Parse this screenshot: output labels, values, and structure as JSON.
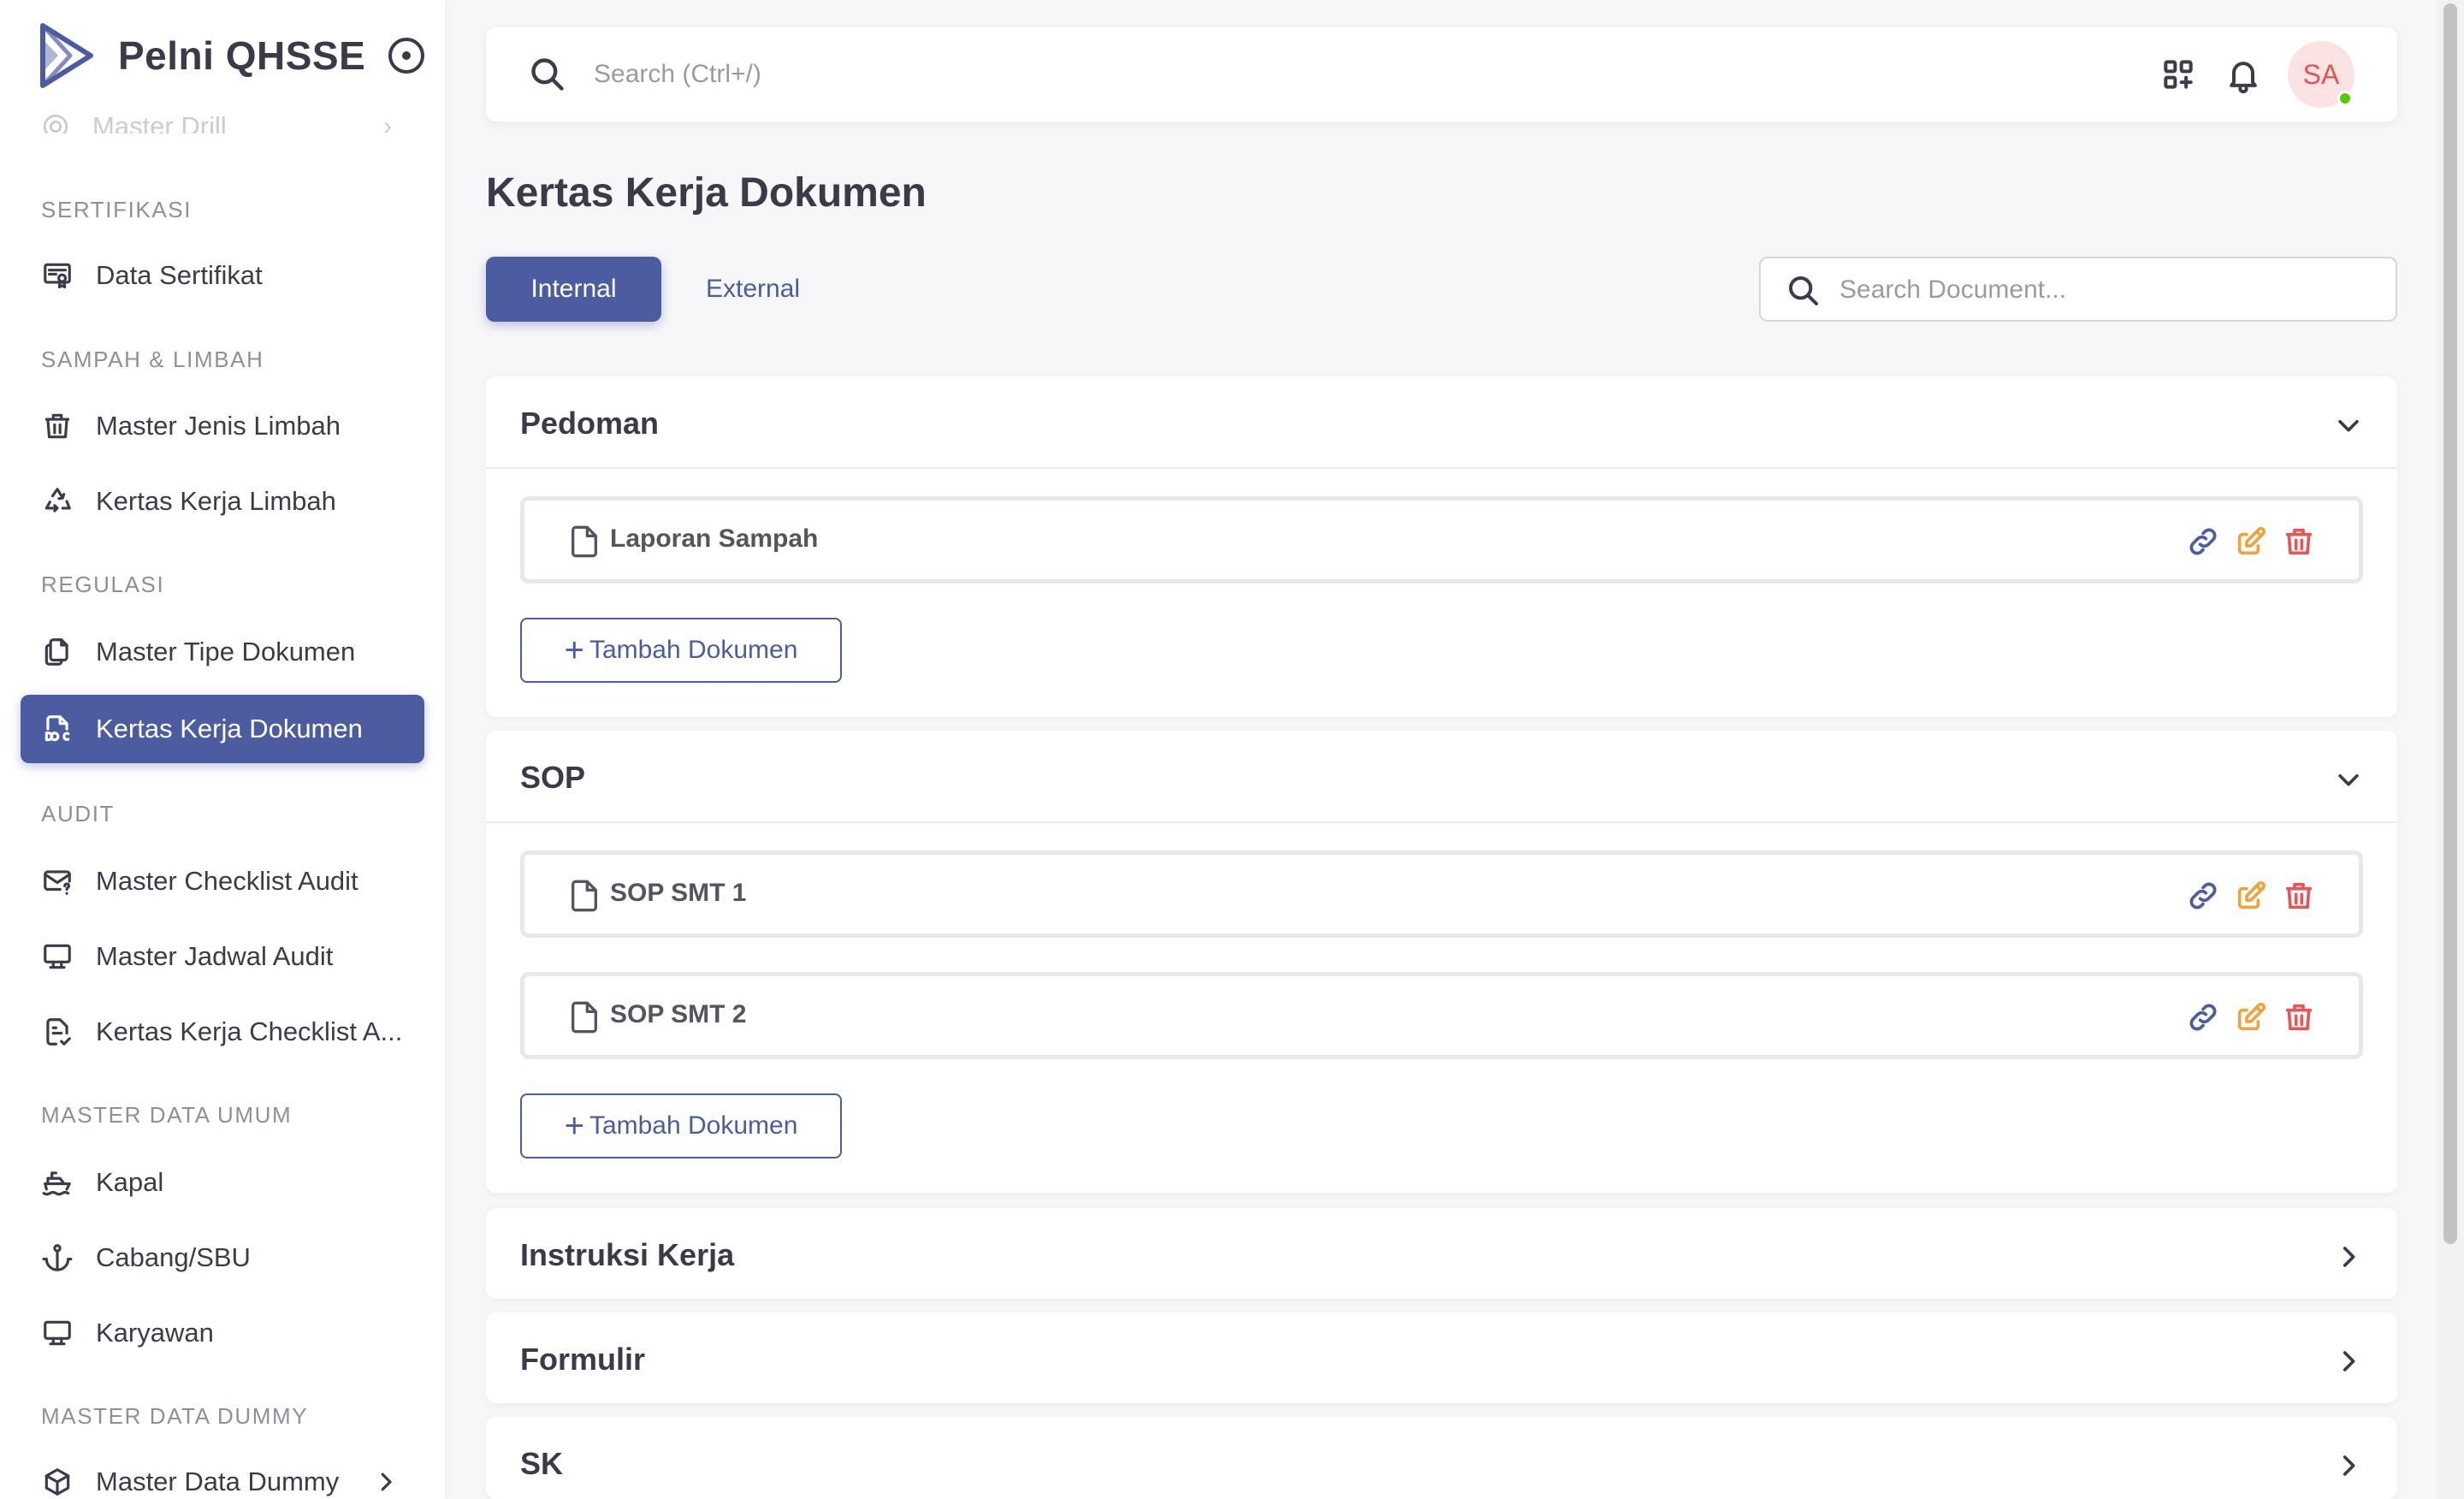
{
  "app": {
    "name": "Pelni QHSSE"
  },
  "sidebar": {
    "ghost_item": {
      "label": "Master Drill"
    },
    "sections": [
      {
        "title": "SERTIFIKASI"
      },
      {
        "title": "SAMPAH & LIMBAH"
      },
      {
        "title": "REGULASI"
      },
      {
        "title": "AUDIT"
      },
      {
        "title": "MASTER DATA UMUM"
      },
      {
        "title": "MASTER DATA DUMMY"
      }
    ],
    "items": [
      {
        "label": "Data Sertifikat",
        "icon": "certificate-icon"
      },
      {
        "label": "Master Jenis Limbah",
        "icon": "trash-icon"
      },
      {
        "label": "Kertas Kerja Limbah",
        "icon": "recycle-icon"
      },
      {
        "label": "Master Tipe Dokumen",
        "icon": "files-icon"
      },
      {
        "label": "Kertas Kerja Dokumen",
        "icon": "file-doc-icon",
        "active": true
      },
      {
        "label": "Master Checklist Audit",
        "icon": "mail-question-icon"
      },
      {
        "label": "Master Jadwal Audit",
        "icon": "monitor-icon"
      },
      {
        "label": "Kertas Kerja Checklist A...",
        "icon": "file-check-icon"
      },
      {
        "label": "Kapal",
        "icon": "ship-icon"
      },
      {
        "label": "Cabang/SBU",
        "icon": "anchor-icon"
      },
      {
        "label": "Karyawan",
        "icon": "monitor-icon"
      },
      {
        "label": "Master Data Dummy",
        "icon": "cube-icon"
      }
    ]
  },
  "topbar": {
    "search_placeholder": "Search (Ctrl+/)",
    "user_initials": "SA"
  },
  "page": {
    "title": "Kertas Kerja Dokumen",
    "tabs": [
      {
        "label": "Internal",
        "active": true
      },
      {
        "label": "External",
        "active": false
      }
    ],
    "doc_search_placeholder": "Search Document..."
  },
  "categories": [
    {
      "title": "Pedoman",
      "expanded": true,
      "documents": [
        "Laporan Sampah"
      ]
    },
    {
      "title": "SOP",
      "expanded": true,
      "documents": [
        "SOP SMT 1",
        "SOP SMT 2"
      ]
    },
    {
      "title": "Instruksi Kerja",
      "expanded": false,
      "documents": []
    },
    {
      "title": "Formulir",
      "expanded": false,
      "documents": []
    },
    {
      "title": "SK",
      "expanded": false,
      "documents": []
    }
  ],
  "add_document_label": "Tambah Dokumen",
  "colors": {
    "primary": "#4b5da0",
    "edit": "#f0a23b",
    "delete": "#e85555",
    "online": "#56ca00"
  }
}
